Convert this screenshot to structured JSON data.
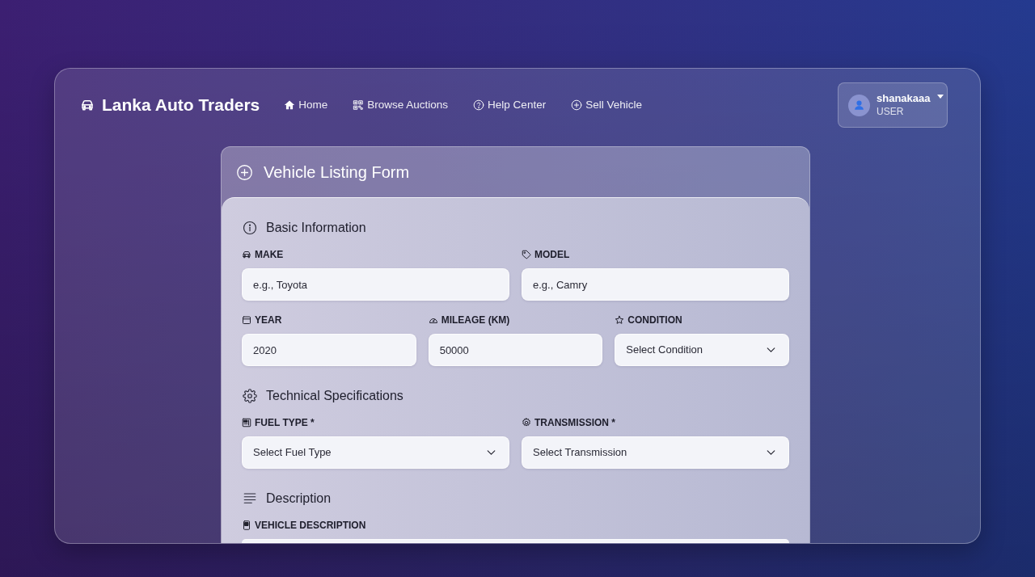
{
  "navbar": {
    "brand": "Lanka Auto Traders",
    "links": [
      {
        "label": "Home"
      },
      {
        "label": "Browse Auctions"
      },
      {
        "label": "Help Center"
      },
      {
        "label": "Sell Vehicle"
      }
    ]
  },
  "user_menu": {
    "name": "shanakaaa",
    "role": "USER"
  },
  "form": {
    "title": "Vehicle Listing Form",
    "sections": [
      {
        "title": "Basic Information",
        "rows": [
          [
            {
              "label": "MAKE",
              "kind": "text",
              "placeholder": "e.g., Toyota"
            },
            {
              "label": "MODEL",
              "kind": "text",
              "placeholder": "e.g., Camry"
            }
          ],
          [
            {
              "label": "YEAR",
              "kind": "text",
              "value": "2020"
            },
            {
              "label": "MILEAGE (KM)",
              "kind": "text",
              "value": "50000"
            },
            {
              "label": "CONDITION",
              "kind": "select",
              "placeholder": "Select Condition"
            }
          ]
        ]
      },
      {
        "title": "Technical Specifications",
        "rows": [
          [
            {
              "label": "FUEL TYPE *",
              "kind": "select",
              "placeholder": "Select Fuel Type"
            },
            {
              "label": "TRANSMISSION *",
              "kind": "select",
              "placeholder": "Select Transmission"
            }
          ]
        ]
      },
      {
        "title": "Description",
        "rows": [
          [
            {
              "label": "VEHICLE DESCRIPTION",
              "kind": "textarea"
            }
          ]
        ]
      }
    ]
  }
}
